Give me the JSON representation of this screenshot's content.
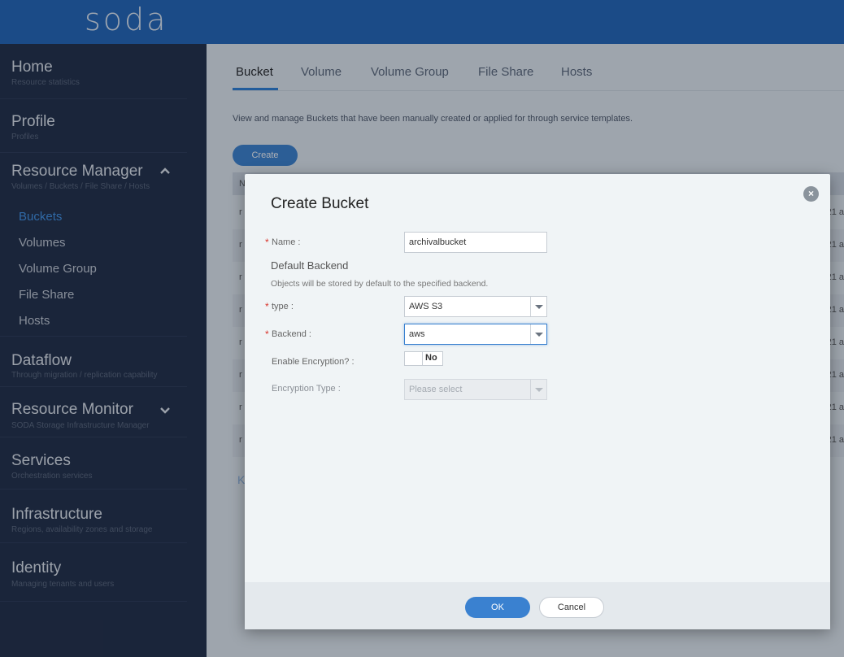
{
  "header": {
    "logo": "soda"
  },
  "sidebar": {
    "home": {
      "title": "Home",
      "subtitle": "Resource statistics"
    },
    "profile": {
      "title": "Profile",
      "subtitle": "Profiles"
    },
    "resource_manager": {
      "title": "Resource Manager",
      "subtitle": "Volumes / Buckets / File Share / Hosts",
      "expanded": true,
      "items": [
        {
          "label": "Buckets",
          "active": true
        },
        {
          "label": "Volumes"
        },
        {
          "label": "Volume Group"
        },
        {
          "label": "File Share"
        },
        {
          "label": "Hosts"
        }
      ]
    },
    "dataflow": {
      "title": "Dataflow",
      "subtitle": "Through migration / replication capability"
    },
    "resource_monitor": {
      "title": "Resource Monitor",
      "subtitle": "SODA Storage Infrastructure Manager"
    },
    "services": {
      "title": "Services",
      "subtitle": "Orchestration services"
    },
    "infrastructure": {
      "title": "Infrastructure",
      "subtitle": "Regions, availability zones and storage"
    },
    "identity": {
      "title": "Identity",
      "subtitle": "Managing tenants and users"
    }
  },
  "main": {
    "tabs": [
      {
        "label": "Bucket",
        "active": true
      },
      {
        "label": "Volume"
      },
      {
        "label": "Volume Group"
      },
      {
        "label": "File Share"
      },
      {
        "label": "Hosts"
      }
    ],
    "description": "View and manage Buckets that have been manually created or applied for through service templates.",
    "create_label": "Create",
    "table": {
      "header_first": "N",
      "rows": [
        {
          "left": "r",
          "right": "21 a"
        },
        {
          "left": "r",
          "right": "21 a"
        },
        {
          "left": "r",
          "right": "21 a"
        },
        {
          "left": "r",
          "right": "21 a"
        },
        {
          "left": "r",
          "right": "21 a"
        },
        {
          "left": "r",
          "right": "21 a"
        },
        {
          "left": "r",
          "right": "21 a"
        },
        {
          "left": "r",
          "right": "21 a"
        }
      ]
    },
    "pager_glyph": "K"
  },
  "dialog": {
    "title": "Create Bucket",
    "close_glyph": "×",
    "name_label": "Name :",
    "name_value": "archivalbucket",
    "section_title": "Default Backend",
    "section_note": "Objects will be stored by default to the specified backend.",
    "type_label": "type :",
    "type_value": "AWS S3",
    "backend_label": "Backend :",
    "backend_value": "aws",
    "encryption_label": "Enable Encryption? :",
    "encryption_value": "No",
    "encryption_type_label": "Encryption Type :",
    "encryption_type_placeholder": "Please select",
    "ok_label": "OK",
    "cancel_label": "Cancel",
    "required_marker": "*"
  },
  "colors": {
    "header": "#1f64b8",
    "sidebar": "#1e2a42",
    "accent": "#3a81d0",
    "active_nav": "#3f93e8",
    "required": "#d9342b"
  }
}
